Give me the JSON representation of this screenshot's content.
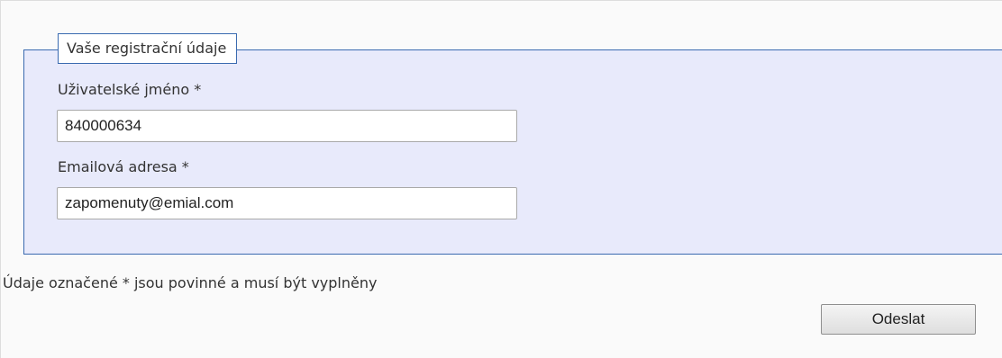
{
  "form": {
    "legend": "Vaše registrační údaje",
    "username": {
      "label": "Uživatelské jméno *",
      "value": "840000634"
    },
    "email": {
      "label": "Emailová adresa *",
      "value": "zapomenuty@emial.com"
    },
    "required_note": "Údaje označené * jsou povinné a musí být vyplněny",
    "submit_label": "Odeslat"
  },
  "colors": {
    "fieldset_background": "#e8eafb",
    "fieldset_border": "#3a6ab0"
  }
}
